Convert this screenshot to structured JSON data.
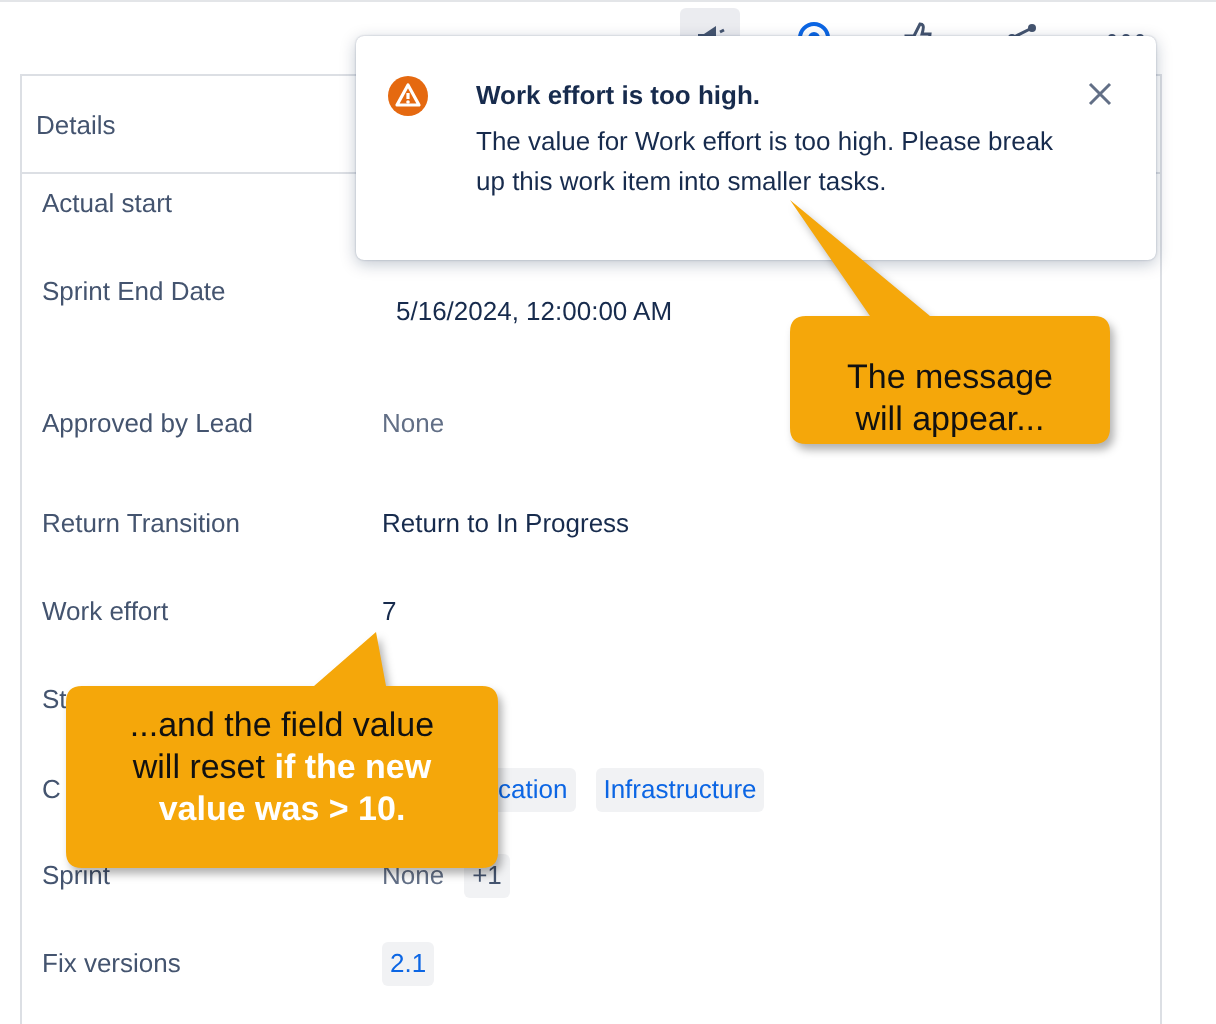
{
  "details": {
    "title": "Details",
    "fields": [
      {
        "label": "Actual start"
      },
      {
        "label": "Sprint End Date",
        "values": [
          {
            "kind": "date",
            "text": "5/16/2024, 12:00:00 AM"
          }
        ]
      },
      {
        "label": "Approved by Lead",
        "values": [
          {
            "kind": "muted",
            "text": "None"
          }
        ]
      },
      {
        "label": "Return Transition",
        "values": [
          {
            "kind": "text",
            "text": "Return to In Progress"
          }
        ]
      },
      {
        "label": "Work effort",
        "values": [
          {
            "kind": "text",
            "text": "7"
          }
        ]
      },
      {
        "label": "St"
      },
      {
        "label": "C",
        "values": [
          {
            "kind": "hidden-link-tag",
            "text": "cation"
          },
          {
            "kind": "link-tag",
            "text": "Infrastructure"
          }
        ]
      },
      {
        "label": "Sprint",
        "values": [
          {
            "kind": "muted",
            "text": "None"
          },
          {
            "kind": "tag",
            "text": "+1"
          }
        ]
      },
      {
        "label": "Fix versions",
        "values": [
          {
            "kind": "link-tag",
            "text": "2.1"
          }
        ]
      }
    ]
  },
  "toast": {
    "title": "Work effort is too high.",
    "message": "The value for Work effort is too high. Please break up this work item into smaller tasks."
  },
  "callouts": [
    {
      "text": "The message will appear..."
    },
    {
      "text": "...and the field value will reset **if the new value was > 10.**"
    }
  ]
}
